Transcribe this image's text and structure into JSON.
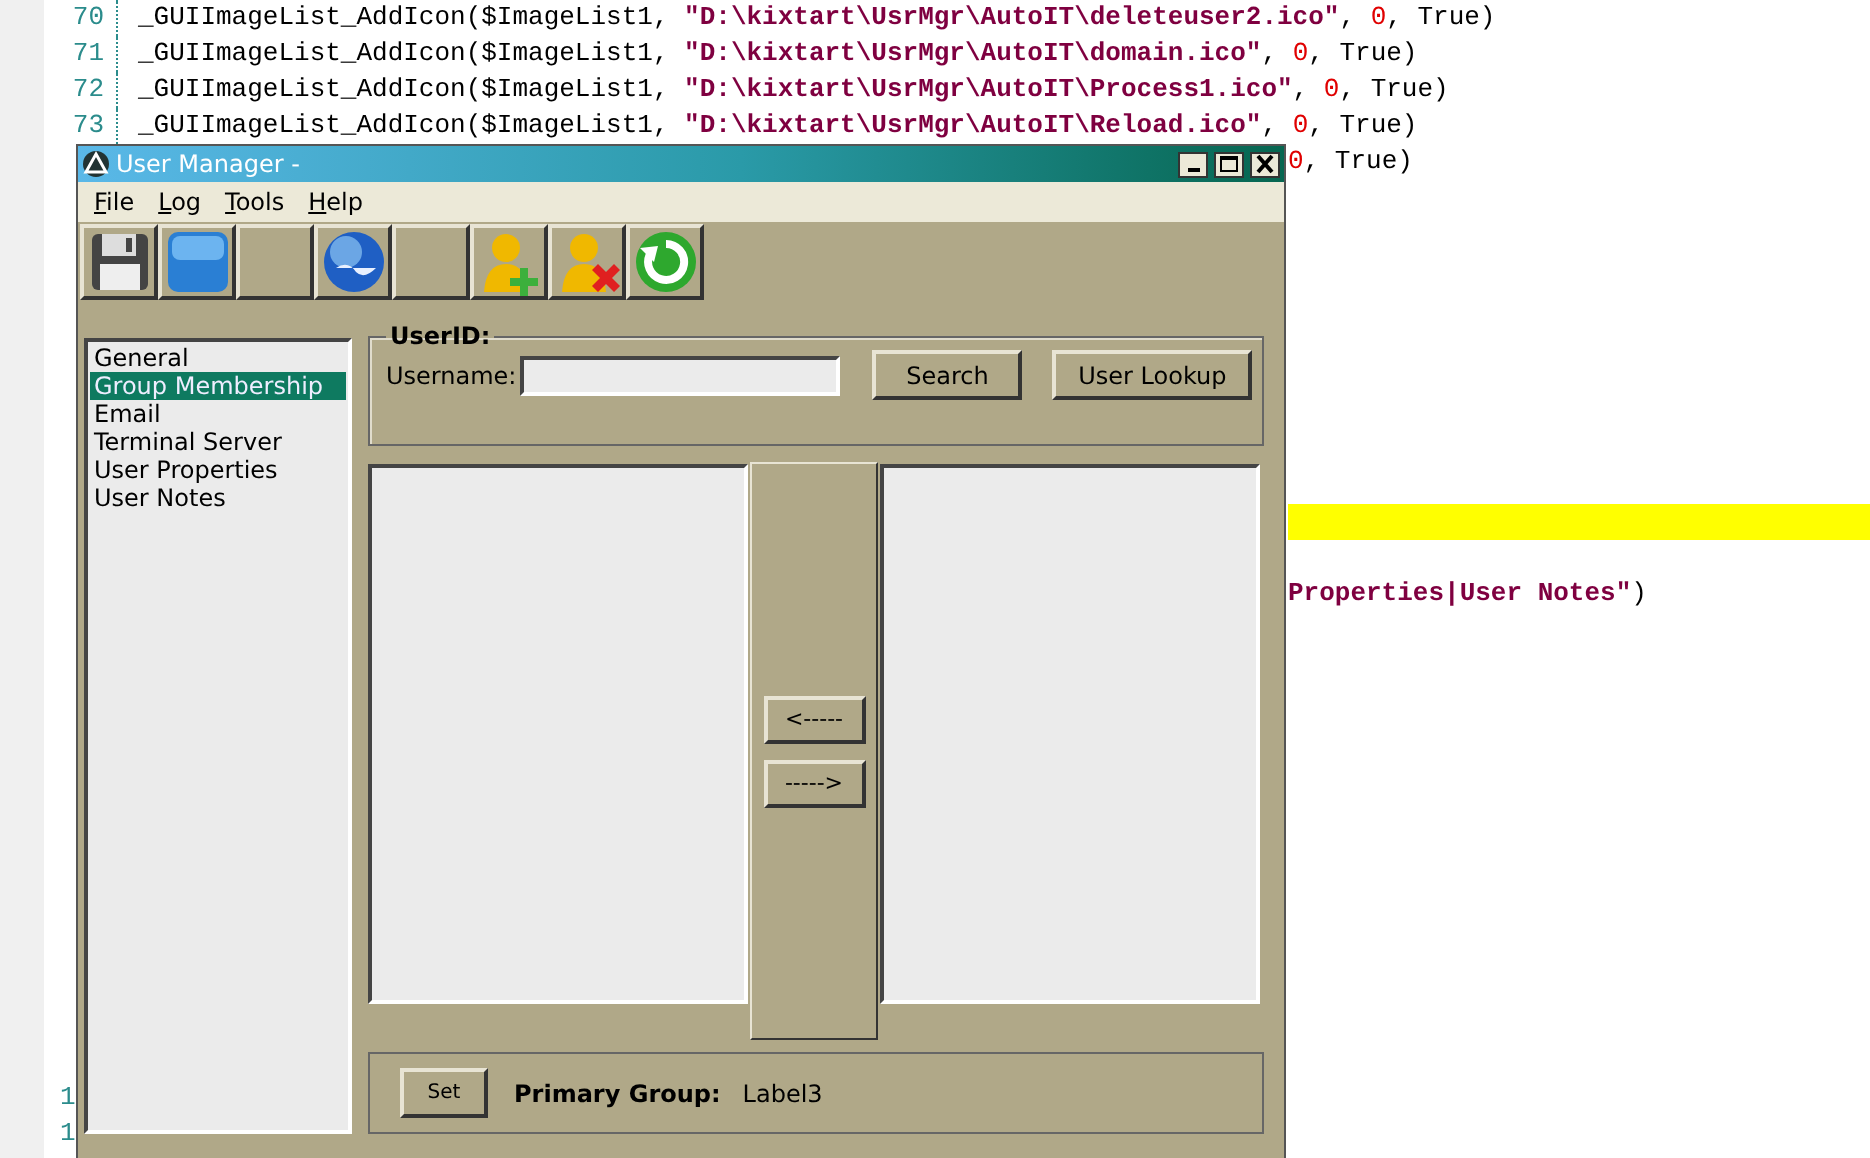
{
  "editor": {
    "lines": [
      {
        "number": "70",
        "kind": "code",
        "segments": [
          {
            "kind": "plain",
            "text": "_GUIImageList_AddIcon($ImageList1, "
          },
          {
            "kind": "string",
            "text": "\"D:\\kixtart\\UsrMgr\\AutoIT\\deleteuser2.ico\""
          },
          {
            "kind": "plain",
            "text": ", "
          },
          {
            "kind": "number",
            "text": "0"
          },
          {
            "kind": "plain",
            "text": ", True)"
          }
        ]
      },
      {
        "number": "71",
        "kind": "code",
        "segments": [
          {
            "kind": "plain",
            "text": "_GUIImageList_AddIcon($ImageList1, "
          },
          {
            "kind": "string",
            "text": "\"D:\\kixtart\\UsrMgr\\AutoIT\\domain.ico\""
          },
          {
            "kind": "plain",
            "text": ", "
          },
          {
            "kind": "number",
            "text": "0"
          },
          {
            "kind": "plain",
            "text": ", True)"
          }
        ]
      },
      {
        "number": "72",
        "kind": "code",
        "segments": [
          {
            "kind": "plain",
            "text": "_GUIImageList_AddIcon($ImageList1, "
          },
          {
            "kind": "string",
            "text": "\"D:\\kixtart\\UsrMgr\\AutoIT\\Process1.ico\""
          },
          {
            "kind": "plain",
            "text": ", "
          },
          {
            "kind": "number",
            "text": "0"
          },
          {
            "kind": "plain",
            "text": ", True)"
          }
        ]
      },
      {
        "number": "73",
        "kind": "code",
        "segments": [
          {
            "kind": "plain",
            "text": "_GUIImageList_AddIcon($ImageList1, "
          },
          {
            "kind": "string",
            "text": "\"D:\\kixtart\\UsrMgr\\AutoIT\\Reload.ico\""
          },
          {
            "kind": "plain",
            "text": ", "
          },
          {
            "kind": "number",
            "text": "0"
          },
          {
            "kind": "plain",
            "text": ", True)"
          }
        ]
      },
      {
        "kind": "tail",
        "segments": [
          {
            "kind": "number",
            "text": "0"
          },
          {
            "kind": "plain",
            "text": ", True)"
          }
        ]
      },
      {
        "kind": "blank"
      },
      {
        "kind": "blank"
      },
      {
        "kind": "blank"
      },
      {
        "kind": "blank"
      },
      {
        "kind": "blank"
      },
      {
        "kind": "blank"
      },
      {
        "kind": "blank"
      },
      {
        "kind": "blank"
      },
      {
        "kind": "blank"
      },
      {
        "kind": "highlight"
      },
      {
        "kind": "blank"
      },
      {
        "kind": "tail",
        "segments": [
          {
            "kind": "string",
            "text": "Properties|User Notes\""
          },
          {
            "kind": "plain",
            "text": ")"
          }
        ]
      },
      {
        "kind": "blank"
      },
      {
        "kind": "blank"
      },
      {
        "kind": "blank"
      },
      {
        "kind": "blank"
      },
      {
        "kind": "blank"
      },
      {
        "kind": "blank"
      },
      {
        "kind": "blank"
      },
      {
        "kind": "blank"
      },
      {
        "kind": "blank"
      },
      {
        "kind": "blank"
      },
      {
        "kind": "blank"
      },
      {
        "kind": "blank"
      },
      {
        "kind": "blank"
      },
      {
        "number": "1",
        "kind": "numonly"
      },
      {
        "number": "1",
        "kind": "numonly"
      }
    ]
  },
  "window": {
    "title": "User Manager -",
    "menu": [
      "File",
      "Log",
      "Tools",
      "Help"
    ],
    "sidebar": {
      "items": [
        {
          "label": "General",
          "selected": false
        },
        {
          "label": "Group Membership",
          "selected": true
        },
        {
          "label": "Email",
          "selected": false
        },
        {
          "label": "Terminal Server",
          "selected": false
        },
        {
          "label": "User Properties",
          "selected": false
        },
        {
          "label": "User Notes",
          "selected": false
        }
      ]
    },
    "userid_group": {
      "title": "UserID:",
      "username_label": "Username:",
      "buttons": [
        "Search",
        "User Lookup"
      ]
    },
    "move_buttons": [
      "<-----",
      "----->"
    ],
    "primary_group": {
      "button": "Set",
      "label": "Primary Group:",
      "value": "Label3"
    }
  }
}
